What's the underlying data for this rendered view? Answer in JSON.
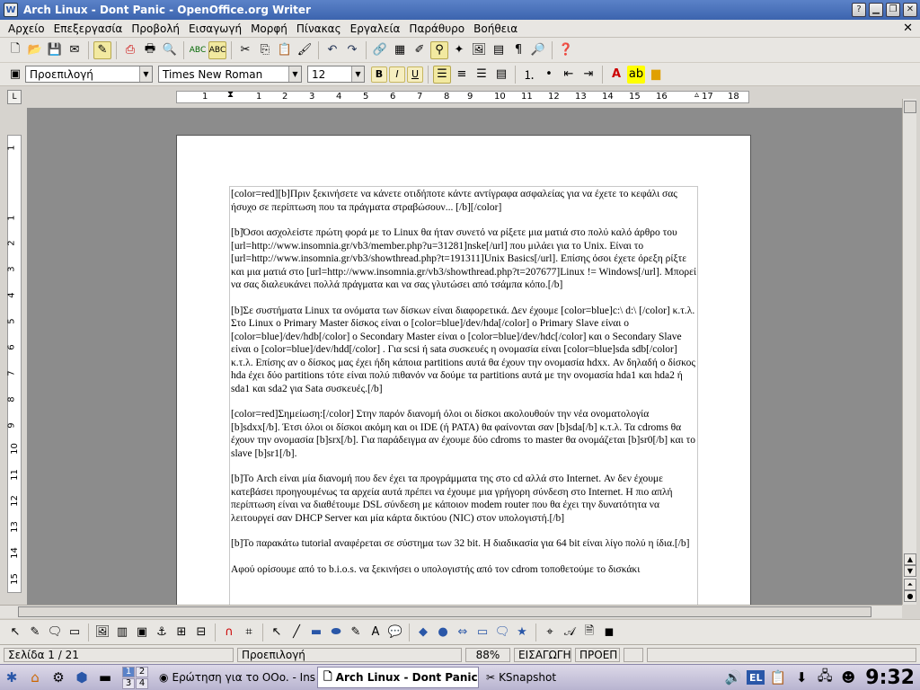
{
  "window": {
    "title": "Arch Linux - Dont Panic - OpenOffice.org Writer"
  },
  "menu": [
    "Αρχείο",
    "Επεξεργασία",
    "Προβολή",
    "Εισαγωγή",
    "Μορφή",
    "Πίνακας",
    "Εργαλεία",
    "Παράθυρο",
    "Βοήθεια"
  ],
  "formatting": {
    "style": "Προεπιλογή",
    "font": "Times New Roman",
    "size": "12",
    "bold": "B",
    "italic": "I",
    "underline": "U"
  },
  "ruler": {
    "h_ticks": [
      "1",
      "1",
      "2",
      "3",
      "4",
      "5",
      "6",
      "7",
      "8",
      "9",
      "10",
      "11",
      "12",
      "13",
      "14",
      "15",
      "16",
      "17",
      "18",
      "19"
    ],
    "v_ticks": [
      "1",
      "1",
      "2",
      "3",
      "4",
      "5",
      "6",
      "7",
      "8",
      "9",
      "10",
      "11",
      "12",
      "13",
      "14",
      "15"
    ]
  },
  "document": {
    "paragraphs": [
      "[color=red][b]Πριν ξεκινήσετε να κάνετε οτιδήποτε κάντε αντίγραφα ασφαλείας για να έχετε το κεφάλι σας ήσυχο σε περίπτωση που τα πράγματα στραβώσουν... [/b][/color]",
      "[b]Όσοι ασχολείστε πρώτη φορά με το Linux θα ήταν συνετό να ρίξετε μια ματιά στο πολύ καλό άρθρο του [url=http://www.insomnia.gr/vb3/member.php?u=31281]nske[/url] που μιλάει για το Unix. Είναι το [url=http://www.insomnia.gr/vb3/showthread.php?t=191311]Unix Basics[/url]. Επίσης όσοι έχετε όρεξη ρίξτε και μια ματιά στο [url=http://www.insomnia.gr/vb3/showthread.php?t=207677]Linux != Windows[/url]. Μπορεί να σας διαλευκάνει πολλά πράγματα και να σας γλυτώσει από τσάμπα κόπο.[/b]",
      "[b]Σε συστήματα Linux τα ονόματα των δίσκων είναι διαφορετικά. Δεν έχουμε [color=blue]c:\\ d:\\ [/color] κ.τ.λ. Στο Linux ο Primary Master δίσκος είναι ο [color=blue]/dev/hda[/color] ο Primary Slave είναι ο [color=blue]/dev/hdb[/color] ο Secondary Master είναι ο [color=blue]/dev/hdc[/color] και ο Secondary Slave είναι ο [color=blue]/dev/hdd[/color] . Για scsi ή sata συσκευές η ονομασία είναι [color=blue]sda sdb[/color] κ.τ.λ. Επίσης αν ο δίσκος μας έχει ήδη κάποια partitions αυτά θα έχουν την ονομασία hdxx. Αν δηλαδή ο δίσκος hda έχει δύο partitions τότε είναι πολύ πιθανόν να δούμε τα partitions αυτά με την ονομασία hda1 και hda2 ή sda1 και sda2 για Sata συσκευές.[/b]",
      "[color=red]Σημείωση:[/color] Στην παρόν διανομή όλοι οι δίσκοι ακολουθούν την νέα ονοματολογία [b]sdxx[/b]. Έτσι όλοι οι δίσκοι ακόμη και οι IDE (ή PATA) θα φαίνονται σαν [b]sda[/b] κ.τ.λ. Τα cdroms θα έχουν την ονομασία [b]srx[/b]. Για παράδειγμα αν έχουμε δύο cdroms το master θα ονομάζεται [b]sr0[/b] και το slave [b]sr1[/b].",
      "[b]Το Arch είναι μία διανομή που δεν έχει τα προγράμματα της στο cd αλλά στο Internet. Αν δεν έχουμε κατεβάσει προηγουμένως τα αρχεία αυτά πρέπει να έχουμε μια γρήγορη σύνδεση στο Internet. Η πιο απλή περίπτωση είναι να διαθέτουμε DSL σύνδεση με κάποιον modem router που θα έχει την δυνατότητα να λειτουργεί σαν DHCP Server και μία κάρτα δικτύου (NIC) στον υπολογιστή.[/b]",
      "[b]Το παρακάτω tutorial αναφέρεται σε σύστημα των 32 bit. Η διαδικασία για 64 bit είναι λίγο πολύ η ίδια.[/b]",
      "Αφού ορίσουμε από το b.i.o.s. να ξεκινήσει ο υπολογιστής από τον cdrom τοποθετούμε το δισκάκι"
    ]
  },
  "status": {
    "page": "Σελίδα 1 / 21",
    "style": "Προεπιλογή",
    "zoom": "88%",
    "insert": "ΕΙΣΑΓΩΓΗ",
    "mode": "ΠΡΟΕΠ"
  },
  "taskbar": {
    "tasks": [
      "Ερώτηση για το OOo. - Insomnia",
      "Arch Linux - Dont Panic - OpenOffice.org Writer",
      "KSnapshot"
    ],
    "pager": [
      "1",
      "2",
      "3",
      "4"
    ],
    "tray": "EL",
    "clock": "9:32"
  }
}
